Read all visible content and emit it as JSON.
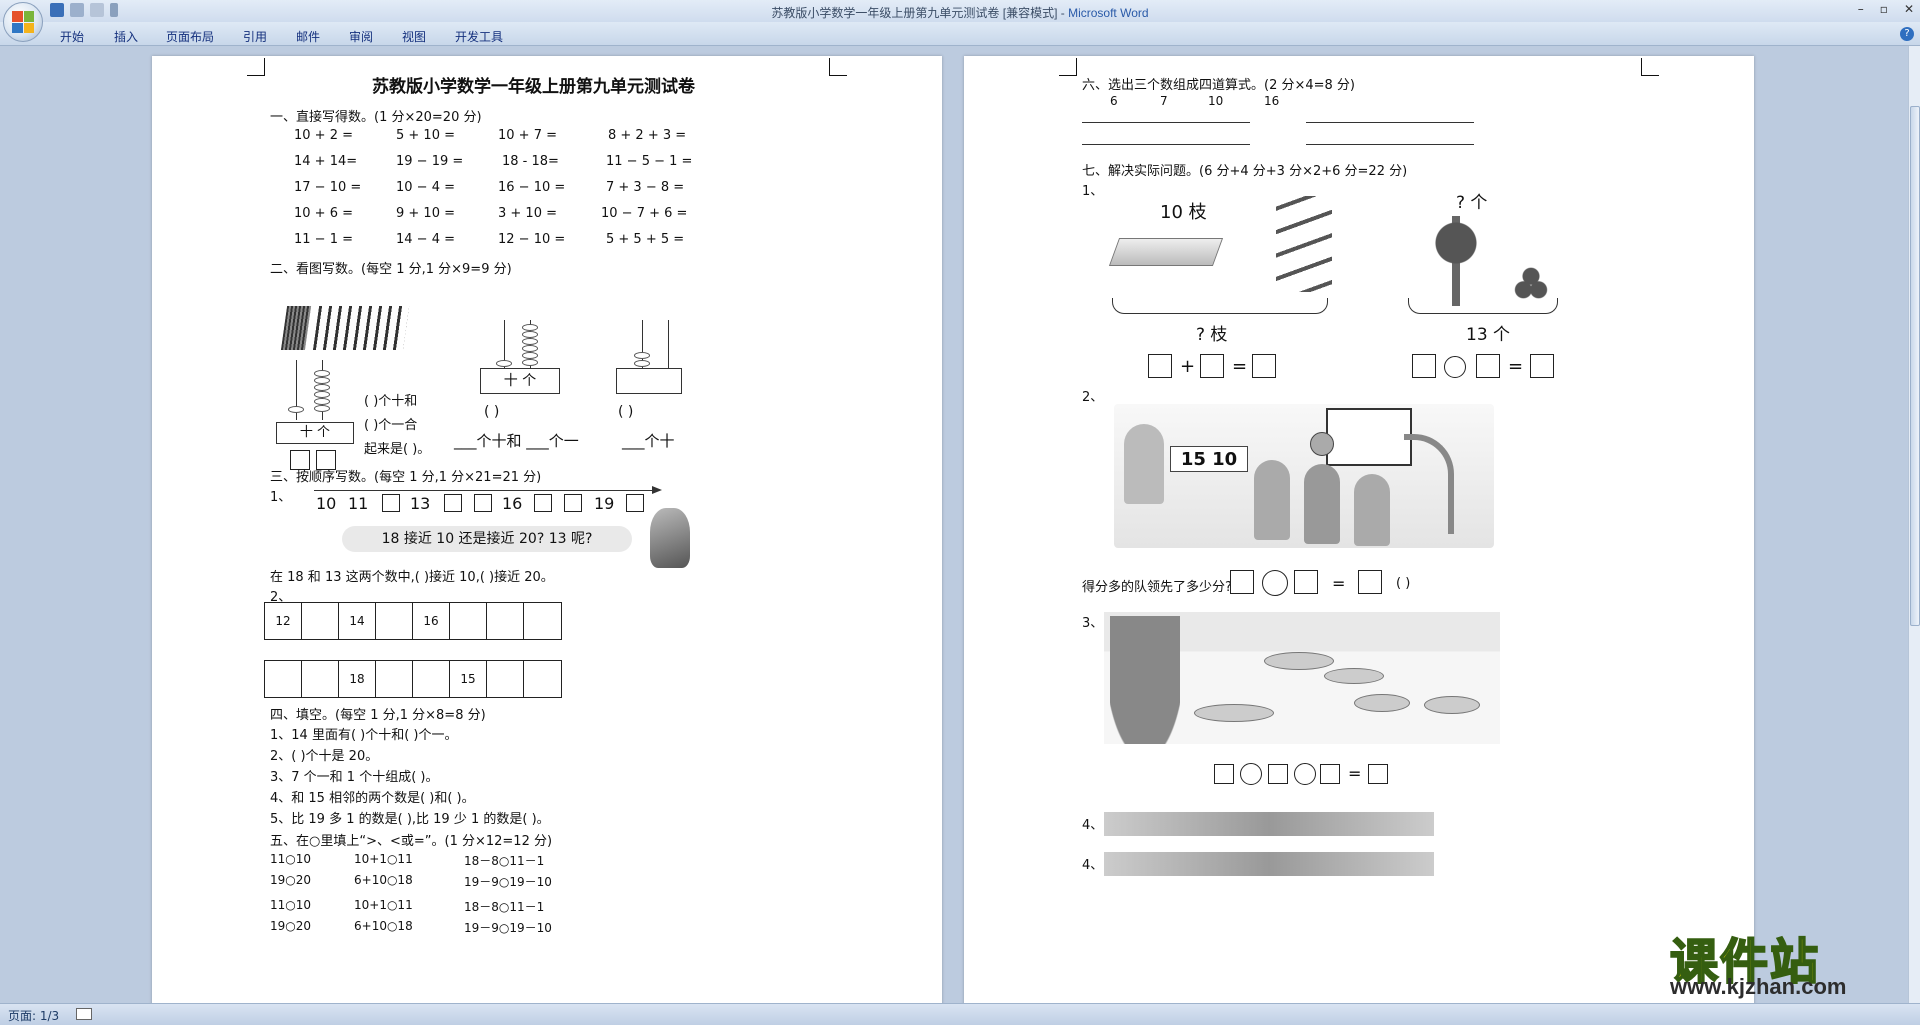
{
  "window": {
    "title": "苏教版小学数学一年级上册第九单元测试卷 [兼容模式] - ",
    "app": "Microsoft Word"
  },
  "ribbon": {
    "tabs": [
      "开始",
      "插入",
      "页面布局",
      "引用",
      "邮件",
      "审阅",
      "视图",
      "开发工具"
    ]
  },
  "status": {
    "page": "页面: 1/3"
  },
  "watermark": {
    "cn": "课件站",
    "url": "www.kjzhan.com"
  },
  "left": {
    "title": "苏教版小学数学一年级上册第九单元测试卷",
    "s1": "一、直接写得数。(1 分×20=20 分)",
    "s1_rows": [
      [
        "10 + 2 =",
        "5 + 10 =",
        "10 + 7 =",
        "8 + 2 + 3 ="
      ],
      [
        "14 + 14=",
        "19 − 19 =",
        "18 - 18=",
        "11 − 5 − 1 ="
      ],
      [
        "17 − 10 =",
        "10 − 4 =",
        "16 − 10 =",
        "7 + 3 − 8 ="
      ],
      [
        "10 + 6 =",
        "9 + 10 =",
        "3 + 10 =",
        "10 − 7 + 6 ="
      ],
      [
        "11 − 1 =",
        "14 − 4 =",
        "12 − 10 =",
        "5 + 5 + 5 ="
      ]
    ],
    "s2": "二、看图写数。(每空 1 分,1 分×9=9 分)",
    "s2_labels": {
      "tens_ones": "十  个",
      "tens_ones_b": "十  个",
      "l1": "(     )个十和",
      "l2": "(     )个一合",
      "l3": "起来是(  )。",
      "p1": "(          )",
      "p2": "(          )",
      "w1": "___个十和 ___个一",
      "w2": "___个十"
    },
    "s3": "三、按顺序写数。(每空 1 分,1 分×21=21 分)",
    "s3_q1": "1、",
    "s3_line": [
      "10",
      "11",
      "13",
      "16",
      "19"
    ],
    "s3_bubble": "18 接近 10 还是接近 20? 13 呢?",
    "s3_fill": "在 18 和 13 这两个数中,(       )接近 10,(       )接近 20。",
    "s3_q2": "2、",
    "s3_row1": [
      "12",
      "",
      "14",
      "",
      "16",
      "",
      "",
      "",
      ""
    ],
    "s3_row2": [
      "",
      "",
      "18",
      "",
      "",
      "15",
      "",
      "",
      ""
    ],
    "s4": "四、填空。(每空 1 分,1 分×8=8 分)",
    "s4_items": [
      "1、14 里面有(        )个十和(        )个一。",
      "2、(        )个十是 20。",
      "3、7 个一和 1 个十组成(        )。",
      "4、和 15 相邻的两个数是(        )和(        )。",
      "5、比 19 多 1 的数是(        ),比 19 少 1 的数是(        )。"
    ],
    "s5": "五、在○里填上“>、<或=”。(1 分×12=12 分)",
    "s5_rows": [
      [
        "11○10",
        "10+1○11",
        "18－8○11－1"
      ],
      [
        "19○20",
        "6+10○18",
        "19－9○19－10"
      ],
      [
        "11○10",
        "10+1○11",
        "18－8○11－1"
      ],
      [
        "19○20",
        "6+10○18",
        "19－9○19－10"
      ]
    ]
  },
  "right": {
    "s6": "六、选出三个数组成四道算式。(2 分×4=8 分)",
    "s6_nums": [
      "6",
      "7",
      "10",
      "16"
    ],
    "s7": "七、解决实际问题。(6 分+4 分+3 分×2+6 分=22 分)",
    "q1": "1、",
    "q1_labels": {
      "a": "10 枝",
      "b": "? 枝",
      "c": "? 个",
      "d": "13 个"
    },
    "q2": "2、",
    "q2_score": "15 10",
    "q2_text": "得分多的队领先了多少分?",
    "q2_paren": "(         )",
    "q3": "3、",
    "q4a": "4、",
    "q4b": "4、"
  }
}
